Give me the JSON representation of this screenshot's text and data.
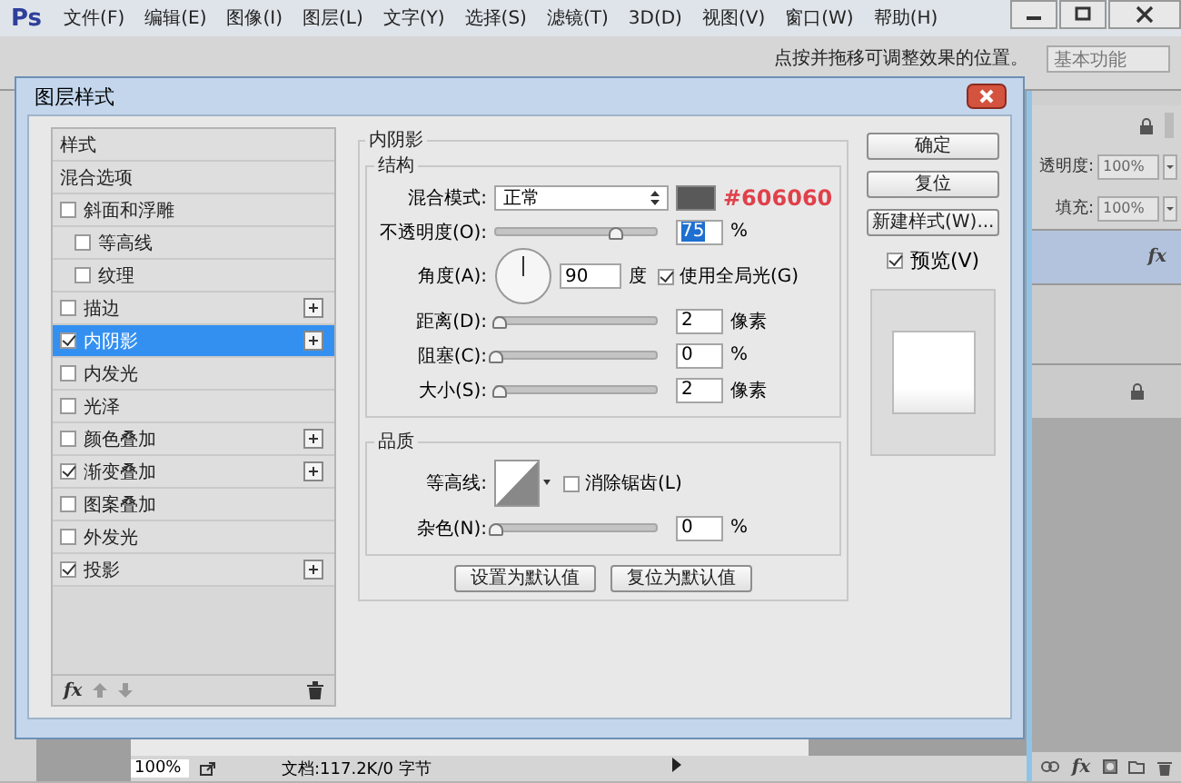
{
  "app": {
    "logo": "Ps",
    "menu": [
      "文件(F)",
      "编辑(E)",
      "图像(I)",
      "图层(L)",
      "文字(Y)",
      "选择(S)",
      "滤镜(T)",
      "3D(D)",
      "视图(V)",
      "窗口(W)",
      "帮助(H)"
    ]
  },
  "options_bar": {
    "hint": "点按并拖移可调整效果的位置。",
    "workspace": "基本功能"
  },
  "layers_panel": {
    "opacity_label": "透明度:",
    "opacity": "100%",
    "fill_label": "填充:",
    "fill": "100%",
    "layer_fx": "fx",
    "footer_fx": "fx",
    "layers": [
      {
        "selected": true
      },
      {
        "selected": false
      },
      {
        "selected": false
      }
    ]
  },
  "status_bar": {
    "zoom": "100%",
    "document": "文档:117.2K/0 字节"
  },
  "dialog": {
    "title": "图层样式",
    "styles": [
      {
        "label": "样式",
        "kind": "header",
        "selected": false
      },
      {
        "label": "混合选项",
        "kind": "header",
        "selected": false
      },
      {
        "label": "斜面和浮雕",
        "kind": "effect",
        "checked": false,
        "selected": false,
        "addable": false,
        "children": [
          {
            "label": "等高线",
            "kind": "effect",
            "checked": false,
            "selected": false,
            "addable": false
          },
          {
            "label": "纹理",
            "kind": "effect",
            "checked": false,
            "selected": false,
            "addable": false
          }
        ]
      },
      {
        "label": "描边",
        "kind": "effect",
        "checked": false,
        "selected": false,
        "addable": true
      },
      {
        "label": "内阴影",
        "kind": "effect",
        "checked": true,
        "selected": true,
        "addable": true
      },
      {
        "label": "内发光",
        "kind": "effect",
        "checked": false,
        "selected": false,
        "addable": false
      },
      {
        "label": "光泽",
        "kind": "effect",
        "checked": false,
        "selected": false,
        "addable": false
      },
      {
        "label": "颜色叠加",
        "kind": "effect",
        "checked": false,
        "selected": false,
        "addable": true
      },
      {
        "label": "渐变叠加",
        "kind": "effect",
        "checked": true,
        "selected": false,
        "addable": true
      },
      {
        "label": "图案叠加",
        "kind": "effect",
        "checked": false,
        "selected": false,
        "addable": false
      },
      {
        "label": "外发光",
        "kind": "effect",
        "checked": false,
        "selected": false,
        "addable": false
      },
      {
        "label": "投影",
        "kind": "effect",
        "checked": true,
        "selected": false,
        "addable": true
      }
    ],
    "list_footer": {
      "fx": "fx"
    },
    "section_title": "内阴影",
    "structure": {
      "title": "结构",
      "blend_mode": {
        "label": "混合模式:",
        "value": "正常",
        "color": "#595959",
        "annotation": "#606060"
      },
      "rows": [
        {
          "kind": "slider",
          "label": "不透明度(O):",
          "level": 0.75,
          "value": "75",
          "unit": "%",
          "selected": true
        },
        {
          "kind": "angle",
          "label": "角度(A):",
          "value": "90",
          "unit": "度",
          "option": {
            "label": "使用全局光(G)",
            "checked": true
          }
        },
        {
          "kind": "slider",
          "label": "距离(D):",
          "level": 0.02,
          "value": "2",
          "unit": "像素",
          "selected": false
        },
        {
          "kind": "slider",
          "label": "阻塞(C):",
          "level": 0,
          "value": "0",
          "unit": "%",
          "selected": false
        },
        {
          "kind": "slider",
          "label": "大小(S):",
          "level": 0.02,
          "value": "2",
          "unit": "像素",
          "selected": false
        }
      ]
    },
    "quality": {
      "title": "品质",
      "contour": {
        "label": "等高线:",
        "option": {
          "label": "消除锯齿(L)",
          "checked": false
        }
      },
      "noise": {
        "kind": "slider",
        "label": "杂色(N):",
        "level": 0,
        "value": "0",
        "unit": "%",
        "selected": false
      }
    },
    "default_buttons": [
      "设置为默认值",
      "复位为默认值"
    ],
    "buttons": [
      "确定",
      "复位",
      "新建样式(W)..."
    ],
    "preview": {
      "label": "预览(V)",
      "checked": true
    }
  }
}
